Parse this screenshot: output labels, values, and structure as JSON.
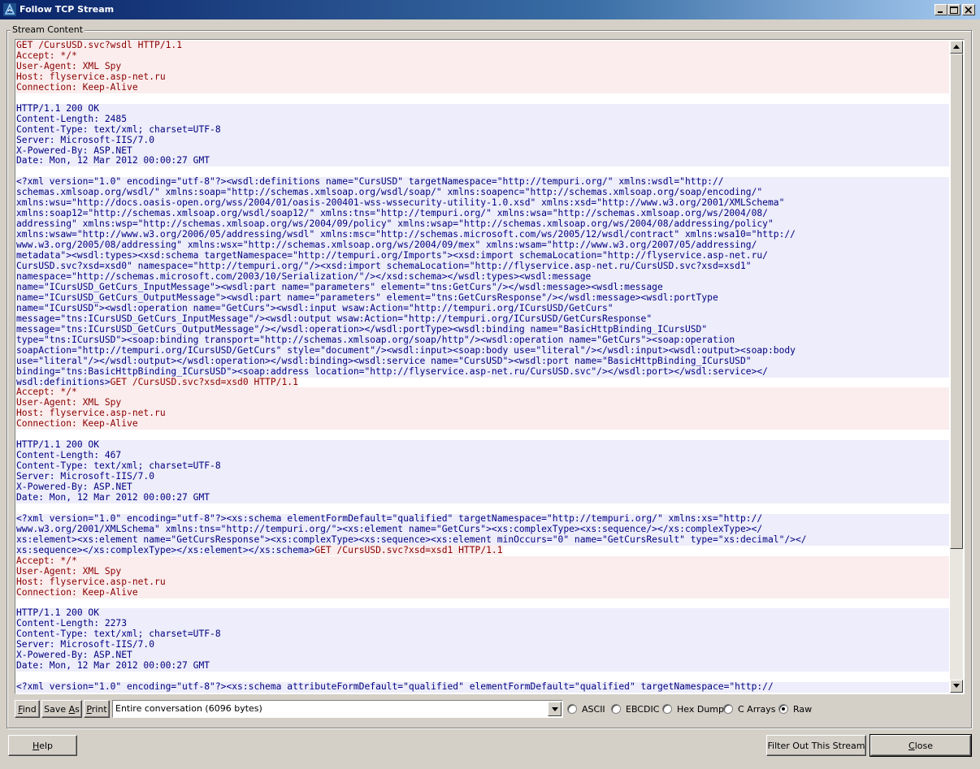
{
  "window": {
    "title": "Follow TCP Stream"
  },
  "stream": {
    "group_label": "Stream Content",
    "lines": [
      {
        "t": "GET /CursUSD.svc?wsdl HTTP/1.1",
        "k": "client"
      },
      {
        "t": "Accept: */*",
        "k": "client"
      },
      {
        "t": "User-Agent: XML Spy",
        "k": "client"
      },
      {
        "t": "Host: flyservice.asp-net.ru",
        "k": "client"
      },
      {
        "t": "Connection: Keep-Alive",
        "k": "client"
      },
      {
        "t": "",
        "k": "blank"
      },
      {
        "t": "HTTP/1.1 200 OK",
        "k": "server"
      },
      {
        "t": "Content-Length: 2485",
        "k": "server"
      },
      {
        "t": "Content-Type: text/xml; charset=UTF-8",
        "k": "server"
      },
      {
        "t": "Server: Microsoft-IIS/7.0",
        "k": "server"
      },
      {
        "t": "X-Powered-By: ASP.NET",
        "k": "server"
      },
      {
        "t": "Date: Mon, 12 Mar 2012 00:00:27 GMT",
        "k": "server"
      },
      {
        "t": "",
        "k": "blank"
      },
      {
        "t": "<?xml version=\"1.0\" encoding=\"utf-8\"?><wsdl:definitions name=\"CursUSD\" targetNamespace=\"http://tempuri.org/\" xmlns:wsdl=\"http://",
        "k": "server"
      },
      {
        "t": "schemas.xmlsoap.org/wsdl/\" xmlns:soap=\"http://schemas.xmlsoap.org/wsdl/soap/\" xmlns:soapenc=\"http://schemas.xmlsoap.org/soap/encoding/\"",
        "k": "server"
      },
      {
        "t": "xmlns:wsu=\"http://docs.oasis-open.org/wss/2004/01/oasis-200401-wss-wssecurity-utility-1.0.xsd\" xmlns:xsd=\"http://www.w3.org/2001/XMLSchema\"",
        "k": "server"
      },
      {
        "t": "xmlns:soap12=\"http://schemas.xmlsoap.org/wsdl/soap12/\" xmlns:tns=\"http://tempuri.org/\" xmlns:wsa=\"http://schemas.xmlsoap.org/ws/2004/08/",
        "k": "server"
      },
      {
        "t": "addressing\" xmlns:wsp=\"http://schemas.xmlsoap.org/ws/2004/09/policy\" xmlns:wsap=\"http://schemas.xmlsoap.org/ws/2004/08/addressing/policy\"",
        "k": "server"
      },
      {
        "t": "xmlns:wsaw=\"http://www.w3.org/2006/05/addressing/wsdl\" xmlns:msc=\"http://schemas.microsoft.com/ws/2005/12/wsdl/contract\" xmlns:wsa10=\"http://",
        "k": "server"
      },
      {
        "t": "www.w3.org/2005/08/addressing\" xmlns:wsx=\"http://schemas.xmlsoap.org/ws/2004/09/mex\" xmlns:wsam=\"http://www.w3.org/2007/05/addressing/",
        "k": "server"
      },
      {
        "t": "metadata\"><wsdl:types><xsd:schema targetNamespace=\"http://tempuri.org/Imports\"><xsd:import schemaLocation=\"http://flyservice.asp-net.ru/",
        "k": "server"
      },
      {
        "t": "CursUSD.svc?xsd=xsd0\" namespace=\"http://tempuri.org/\"/><xsd:import schemaLocation=\"http://flyservice.asp-net.ru/CursUSD.svc?xsd=xsd1\"",
        "k": "server"
      },
      {
        "t": "namespace=\"http://schemas.microsoft.com/2003/10/Serialization/\"/></xsd:schema></wsdl:types><wsdl:message",
        "k": "server"
      },
      {
        "t": "name=\"ICursUSD_GetCurs_InputMessage\"><wsdl:part name=\"parameters\" element=\"tns:GetCurs\"/></wsdl:message><wsdl:message",
        "k": "server"
      },
      {
        "t": "name=\"ICursUSD_GetCurs_OutputMessage\"><wsdl:part name=\"parameters\" element=\"tns:GetCursResponse\"/></wsdl:message><wsdl:portType",
        "k": "server"
      },
      {
        "t": "name=\"ICursUSD\"><wsdl:operation name=\"GetCurs\"><wsdl:input wsaw:Action=\"http://tempuri.org/ICursUSD/GetCurs\"",
        "k": "server"
      },
      {
        "t": "message=\"tns:ICursUSD_GetCurs_InputMessage\"/><wsdl:output wsaw:Action=\"http://tempuri.org/ICursUSD/GetCursResponse\"",
        "k": "server"
      },
      {
        "t": "message=\"tns:ICursUSD_GetCurs_OutputMessage\"/></wsdl:operation></wsdl:portType><wsdl:binding name=\"BasicHttpBinding_ICursUSD\"",
        "k": "server"
      },
      {
        "t": "type=\"tns:ICursUSD\"><soap:binding transport=\"http://schemas.xmlsoap.org/soap/http\"/><wsdl:operation name=\"GetCurs\"><soap:operation",
        "k": "server"
      },
      {
        "t": "soapAction=\"http://tempuri.org/ICursUSD/GetCurs\" style=\"document\"/><wsdl:input><soap:body use=\"literal\"/></wsdl:input><wsdl:output><soap:body",
        "k": "server"
      },
      {
        "t": "use=\"literal\"/></wsdl:output></wsdl:operation></wsdl:binding><wsdl:service name=\"CursUSD\"><wsdl:port name=\"BasicHttpBinding_ICursUSD\"",
        "k": "server"
      },
      {
        "t": "binding=\"tns:BasicHttpBinding_ICursUSD\"><soap:address location=\"http://flyservice.asp-net.ru/CursUSD.svc\"/></wsdl:port></wsdl:service></",
        "k": "server"
      },
      {
        "segs": [
          {
            "t": "wsdl:definitions>",
            "k": "server"
          },
          {
            "t": "GET /CursUSD.svc?xsd=xsd0 HTTP/1.1",
            "k": "client"
          }
        ]
      },
      {
        "t": "Accept: */*",
        "k": "client"
      },
      {
        "t": "User-Agent: XML Spy",
        "k": "client"
      },
      {
        "t": "Host: flyservice.asp-net.ru",
        "k": "client"
      },
      {
        "t": "Connection: Keep-Alive",
        "k": "client"
      },
      {
        "t": "",
        "k": "blank"
      },
      {
        "t": "HTTP/1.1 200 OK",
        "k": "server"
      },
      {
        "t": "Content-Length: 467",
        "k": "server"
      },
      {
        "t": "Content-Type: text/xml; charset=UTF-8",
        "k": "server"
      },
      {
        "t": "Server: Microsoft-IIS/7.0",
        "k": "server"
      },
      {
        "t": "X-Powered-By: ASP.NET",
        "k": "server"
      },
      {
        "t": "Date: Mon, 12 Mar 2012 00:00:27 GMT",
        "k": "server"
      },
      {
        "t": "",
        "k": "blank"
      },
      {
        "t": "<?xml version=\"1.0\" encoding=\"utf-8\"?><xs:schema elementFormDefault=\"qualified\" targetNamespace=\"http://tempuri.org/\" xmlns:xs=\"http://",
        "k": "server"
      },
      {
        "t": "www.w3.org/2001/XMLSchema\" xmlns:tns=\"http://tempuri.org/\"><xs:element name=\"GetCurs\"><xs:complexType><xs:sequence/></xs:complexType></",
        "k": "server"
      },
      {
        "t": "xs:element><xs:element name=\"GetCursResponse\"><xs:complexType><xs:sequence><xs:element minOccurs=\"0\" name=\"GetCursResult\" type=\"xs:decimal\"/></",
        "k": "server"
      },
      {
        "segs": [
          {
            "t": "xs:sequence></xs:complexType></xs:element></xs:schema>",
            "k": "server"
          },
          {
            "t": "GET /CursUSD.svc?xsd=xsd1 HTTP/1.1",
            "k": "client"
          }
        ]
      },
      {
        "t": "Accept: */*",
        "k": "client"
      },
      {
        "t": "User-Agent: XML Spy",
        "k": "client"
      },
      {
        "t": "Host: flyservice.asp-net.ru",
        "k": "client"
      },
      {
        "t": "Connection: Keep-Alive",
        "k": "client"
      },
      {
        "t": "",
        "k": "blank"
      },
      {
        "t": "HTTP/1.1 200 OK",
        "k": "server"
      },
      {
        "t": "Content-Length: 2273",
        "k": "server"
      },
      {
        "t": "Content-Type: text/xml; charset=UTF-8",
        "k": "server"
      },
      {
        "t": "Server: Microsoft-IIS/7.0",
        "k": "server"
      },
      {
        "t": "X-Powered-By: ASP.NET",
        "k": "server"
      },
      {
        "t": "Date: Mon, 12 Mar 2012 00:00:27 GMT",
        "k": "server"
      },
      {
        "t": "",
        "k": "blank"
      },
      {
        "t": "<?xml version=\"1.0\" encoding=\"utf-8\"?><xs:schema attributeFormDefault=\"qualified\" elementFormDefault=\"qualified\" targetNamespace=\"http://",
        "k": "server"
      }
    ]
  },
  "colors": {
    "client_text": "#8b0000",
    "client_bg": "#fbeded",
    "server_text": "#000080",
    "server_bg": "#ededfb"
  },
  "toolbar": {
    "find": {
      "pre": "",
      "u": "F",
      "post": "ind"
    },
    "save_as": {
      "pre": "Save ",
      "u": "A",
      "post": "s"
    },
    "print": {
      "pre": "",
      "u": "P",
      "post": "rint"
    },
    "conversation_select": "Entire conversation (6096 bytes)",
    "formats": [
      {
        "label": "ASCII",
        "checked": false
      },
      {
        "label": "EBCDIC",
        "checked": false
      },
      {
        "label": "Hex Dump",
        "checked": false
      },
      {
        "label": "C Arrays",
        "checked": false
      },
      {
        "label": "Raw",
        "checked": true
      }
    ]
  },
  "footer": {
    "help": {
      "pre": "",
      "u": "H",
      "post": "elp"
    },
    "filter_out": "Filter Out This Stream",
    "close": {
      "pre": "",
      "u": "C",
      "post": "lose"
    }
  },
  "icons": {
    "app": "wireshark-fin-icon",
    "minimize": "minimize-icon",
    "maximize": "maximize-icon",
    "close": "close-icon",
    "dropdown": "chevron-down-icon",
    "scroll_up": "scroll-up-arrow-icon",
    "scroll_down": "scroll-down-arrow-icon"
  }
}
